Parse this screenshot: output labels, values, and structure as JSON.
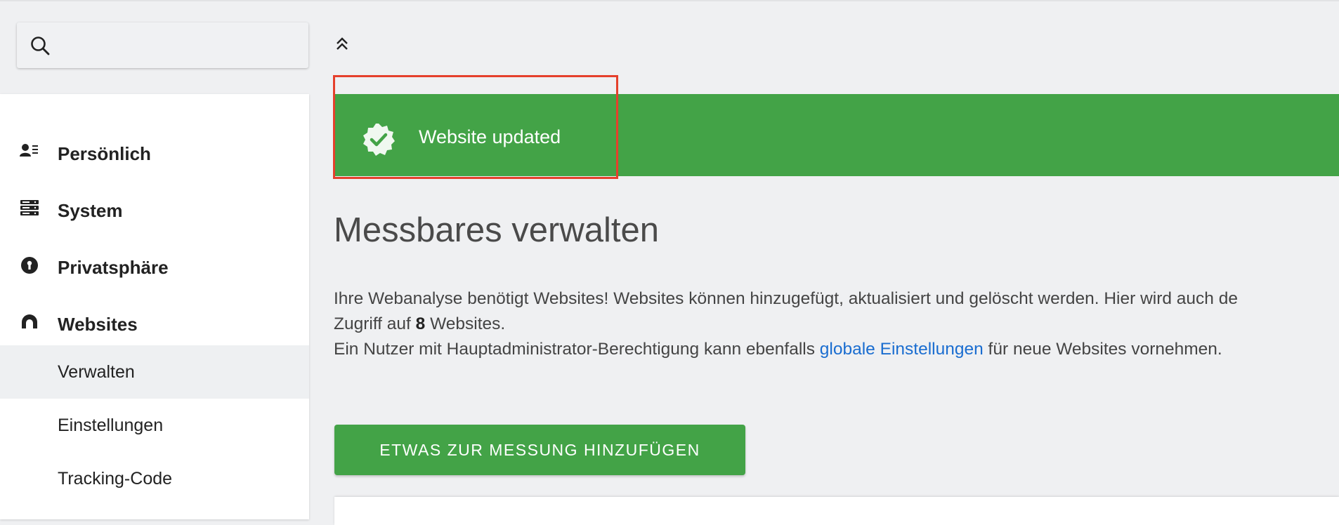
{
  "search": {
    "value": "",
    "placeholder": "",
    "icon": "search-icon"
  },
  "sidebar": {
    "categories": [
      {
        "label": "Persönlich",
        "icon": "personal-icon"
      },
      {
        "label": "System",
        "icon": "server-icon"
      },
      {
        "label": "Privatsphäre",
        "icon": "privacy-icon"
      },
      {
        "label": "Websites",
        "icon": "websites-icon"
      }
    ],
    "subitems": [
      {
        "label": "Verwalten",
        "active": true
      },
      {
        "label": "Einstellungen",
        "active": false
      },
      {
        "label": "Tracking-Code",
        "active": false
      }
    ]
  },
  "notification": {
    "message": "Website updated",
    "icon": "check-badge-icon",
    "color": "#43a347",
    "highlight_color": "#e5402c"
  },
  "page": {
    "title": "Messbares verwalten",
    "para_line1": "Ihre Webanalyse benötigt Websites! Websites können hinzugefügt, aktualisiert und gelöscht werden. Hier wird auch de",
    "para_line2_pre": "Zugriff auf ",
    "para_line2_count": "8",
    "para_line2_post": " Websites.",
    "para_line3_pre": "Ein Nutzer mit Hauptadministrator-Berechtigung kann ebenfalls ",
    "para_line3_link": "globale Einstellungen",
    "para_line3_post": " für neue Websites vornehmen.",
    "add_button": "ETWAS ZUR MESSUNG HINZUFÜGEN",
    "link_color": "#1a6dd0"
  },
  "collapse_icon": "double-chevron-up-icon"
}
